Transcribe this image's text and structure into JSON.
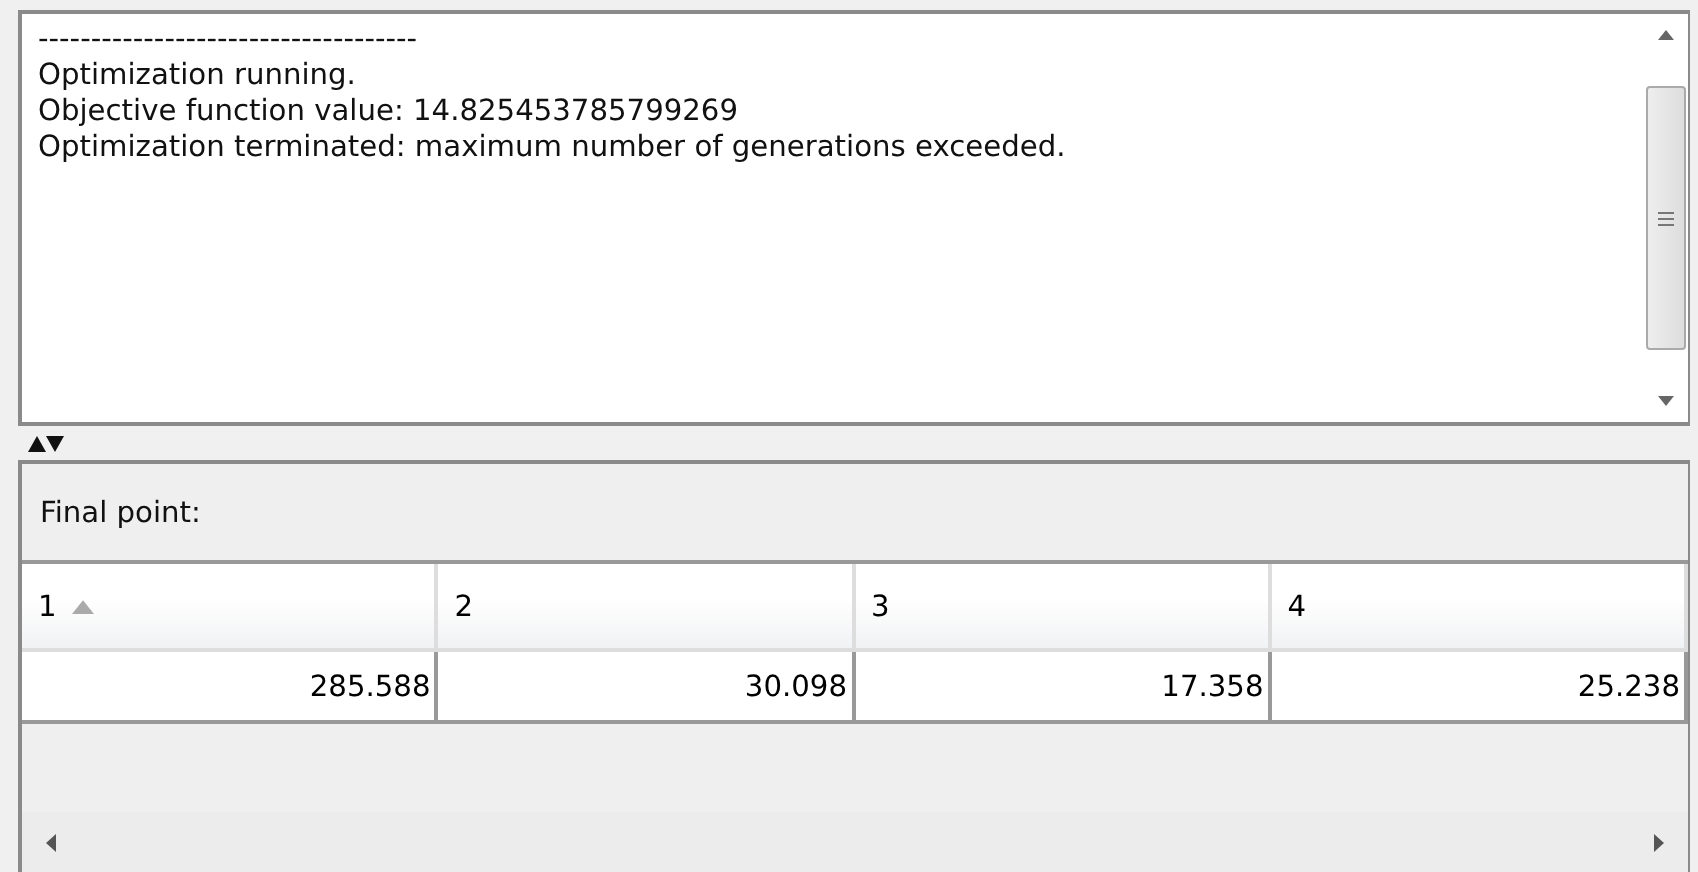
{
  "log": {
    "lines": [
      "------------------------------------",
      "Optimization running.",
      "Objective function value: 14.825453785799269",
      "Optimization terminated: maximum number of generations exceeded."
    ]
  },
  "final_point": {
    "label": "Final point:",
    "columns": [
      {
        "label": "1",
        "sorted_ascending": true
      },
      {
        "label": "2",
        "sorted_ascending": false
      },
      {
        "label": "3",
        "sorted_ascending": false
      },
      {
        "label": "4",
        "sorted_ascending": false
      }
    ],
    "rows": [
      [
        "285.588",
        "30.098",
        "17.358",
        "25.238"
      ]
    ]
  }
}
